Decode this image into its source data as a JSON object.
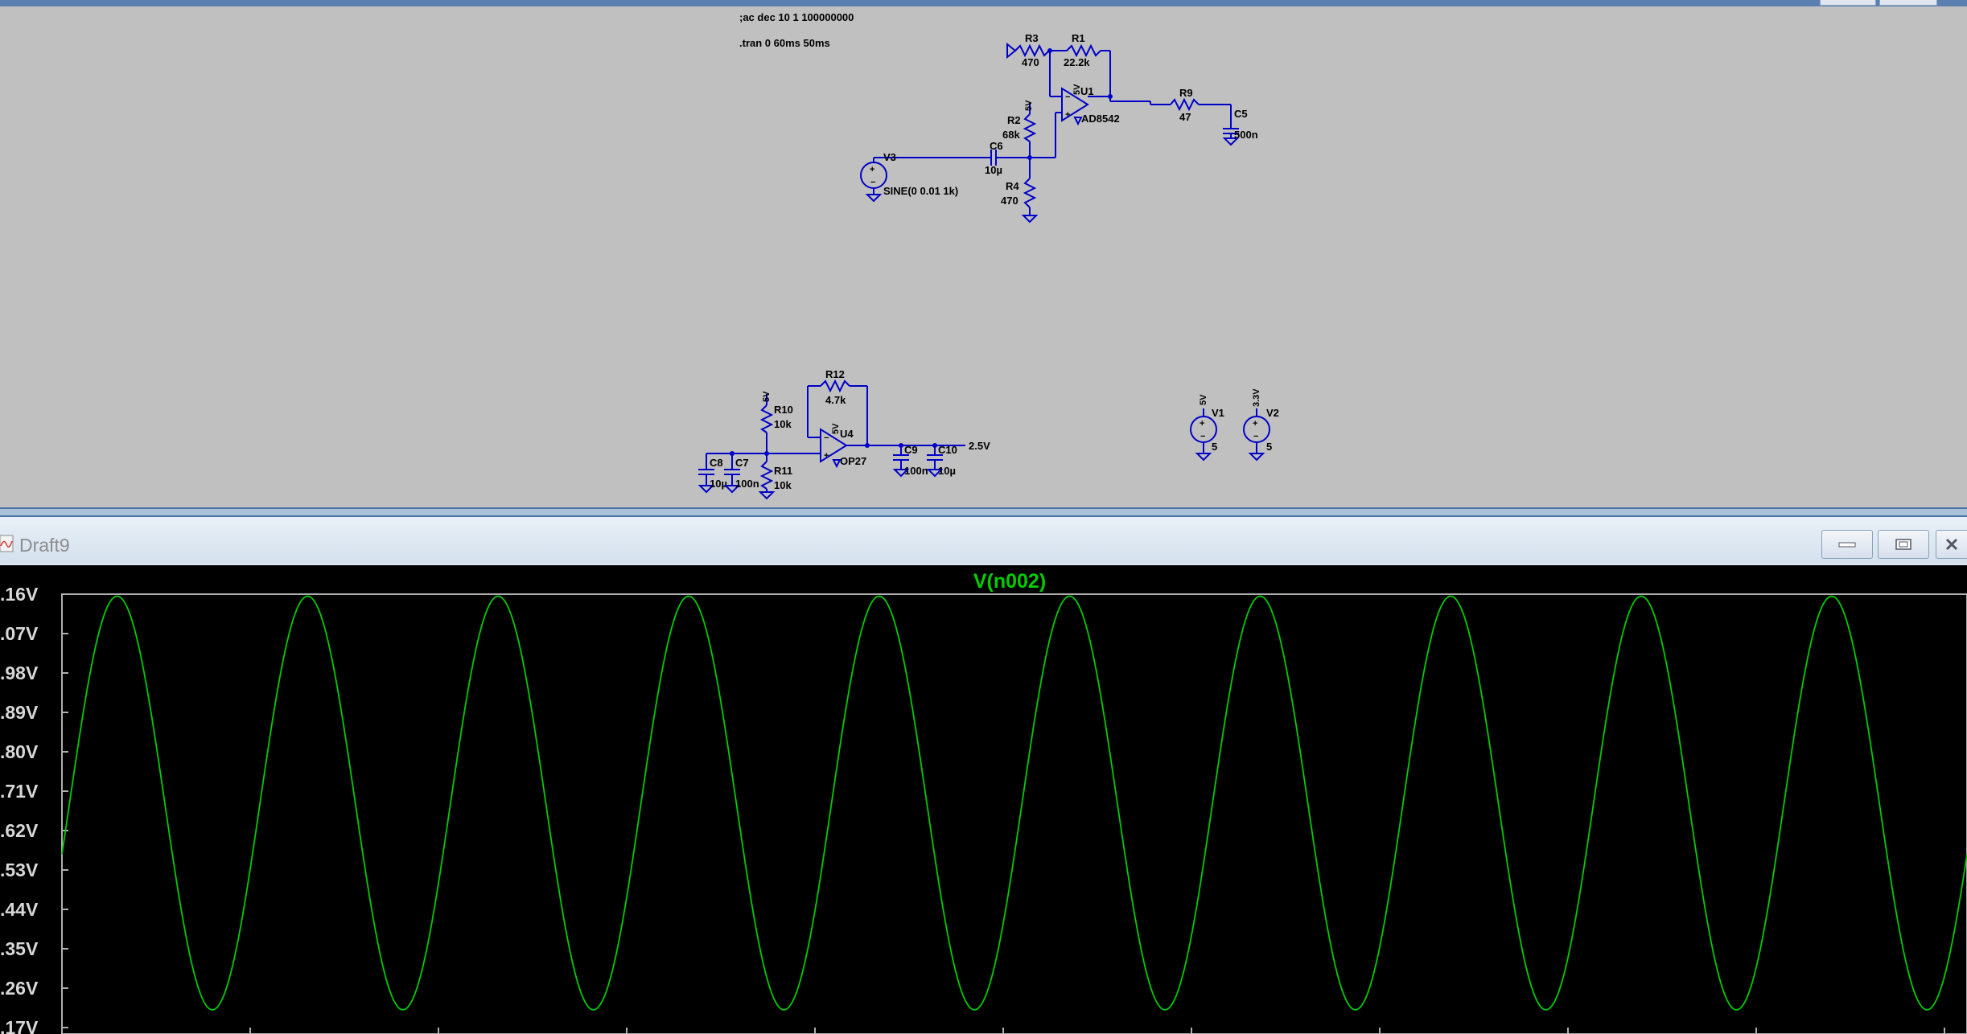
{
  "directives": {
    "ac": ";ac dec 10 1 100000000",
    "tran": ".tran 0 60ms 50ms"
  },
  "components": {
    "r3": {
      "name": "R3",
      "value": "470"
    },
    "r1": {
      "name": "R1",
      "value": "22.2k"
    },
    "u1": {
      "name": "U1",
      "value": "AD8542",
      "supply": "5V"
    },
    "r9": {
      "name": "R9",
      "value": "47"
    },
    "c5": {
      "name": "C5",
      "value": "500n"
    },
    "r2": {
      "name": "R2",
      "value": "68k",
      "supply": "5V"
    },
    "c6": {
      "name": "C6",
      "value": "10µ"
    },
    "v3": {
      "name": "V3",
      "value": "SINE(0 0.01 1k)"
    },
    "r4": {
      "name": "R4",
      "value": "470"
    },
    "r12": {
      "name": "R12",
      "value": "4.7k"
    },
    "r10": {
      "name": "R10",
      "value": "10k",
      "supply": "5V"
    },
    "u4": {
      "name": "U4",
      "value": "OP27",
      "supply": "5V"
    },
    "c8": {
      "name": "C8",
      "value": "10µ"
    },
    "c7": {
      "name": "C7",
      "value": "100n"
    },
    "r11": {
      "name": "R11",
      "value": "10k"
    },
    "c9": {
      "name": "C9",
      "value": "100n"
    },
    "c10": {
      "name": "C10",
      "value": "10µ"
    },
    "net_label": "2.5V",
    "v1": {
      "name": "V1",
      "value": "5",
      "net": "5V"
    },
    "v2": {
      "name": "V2",
      "value": "5",
      "net": "3.3V"
    }
  },
  "plot_window": {
    "title": "Draft9",
    "icons": {
      "app": "waveform-icon",
      "minimize": "minimize-icon",
      "maximize": "maximize-icon",
      "close": "close-icon"
    }
  },
  "chart_data": {
    "type": "line",
    "title": "V(n002)",
    "y_tick_labels": [
      ".16V",
      ".07V",
      ".98V",
      ".89V",
      ".80V",
      ".71V",
      ".62V",
      ".53V",
      ".44V",
      ".35V",
      ".26V",
      ".17V"
    ],
    "series": [
      {
        "name": "V(n002)",
        "color": "#00cc00",
        "waveform": "sine",
        "cycles_visible": 10,
        "peak_tick": 0.05,
        "trough_tick": 10.55,
        "start_tick": 6.6,
        "end_tick": 6.8
      }
    ],
    "grid": false,
    "background": "#000000",
    "trace_color": "#00cc00"
  },
  "colors": {
    "schematic_bg": "#c0c0c0",
    "wire": "#0000c8",
    "plot_bg": "#000000",
    "trace": "#00cc00"
  }
}
